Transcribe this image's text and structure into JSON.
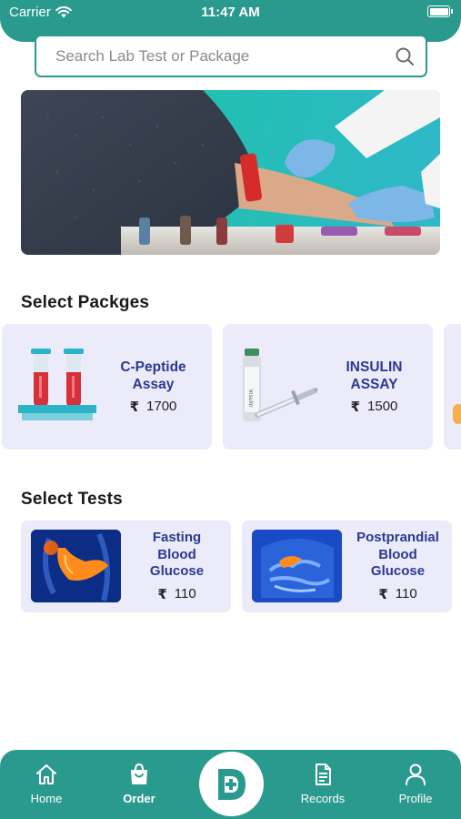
{
  "status_bar": {
    "carrier": "Carrier",
    "time": "11:47 AM"
  },
  "search": {
    "placeholder": "Search Lab Test or Package"
  },
  "sections": {
    "packages_title": "Select Packges",
    "tests_title": "Select Tests"
  },
  "packages": [
    {
      "name_line1": "C-Peptide",
      "name_line2": "Assay",
      "currency": "₹",
      "price": "1700",
      "icon": "test-tubes-icon"
    },
    {
      "name_line1": "INSULIN",
      "name_line2": "ASSAY",
      "currency": "₹",
      "price": "1500",
      "icon": "insulin-syringe-icon"
    }
  ],
  "tests": [
    {
      "name_line1": "Fasting",
      "name_line2": "Blood",
      "name_line3": "Glucose",
      "currency": "₹",
      "price": "110",
      "icon": "pancreas-icon"
    },
    {
      "name_line1": "Postprandial",
      "name_line2": "Blood",
      "name_line3": "Glucose",
      "currency": "₹",
      "price": "110",
      "icon": "digestive-system-icon"
    }
  ],
  "bottom_nav": {
    "home": "Home",
    "order": "Order",
    "records": "Records",
    "profile": "Profile"
  },
  "colors": {
    "primary": "#2b9a8e",
    "card_bg": "#ecebfa",
    "title_blue": "#2b3a8f"
  }
}
